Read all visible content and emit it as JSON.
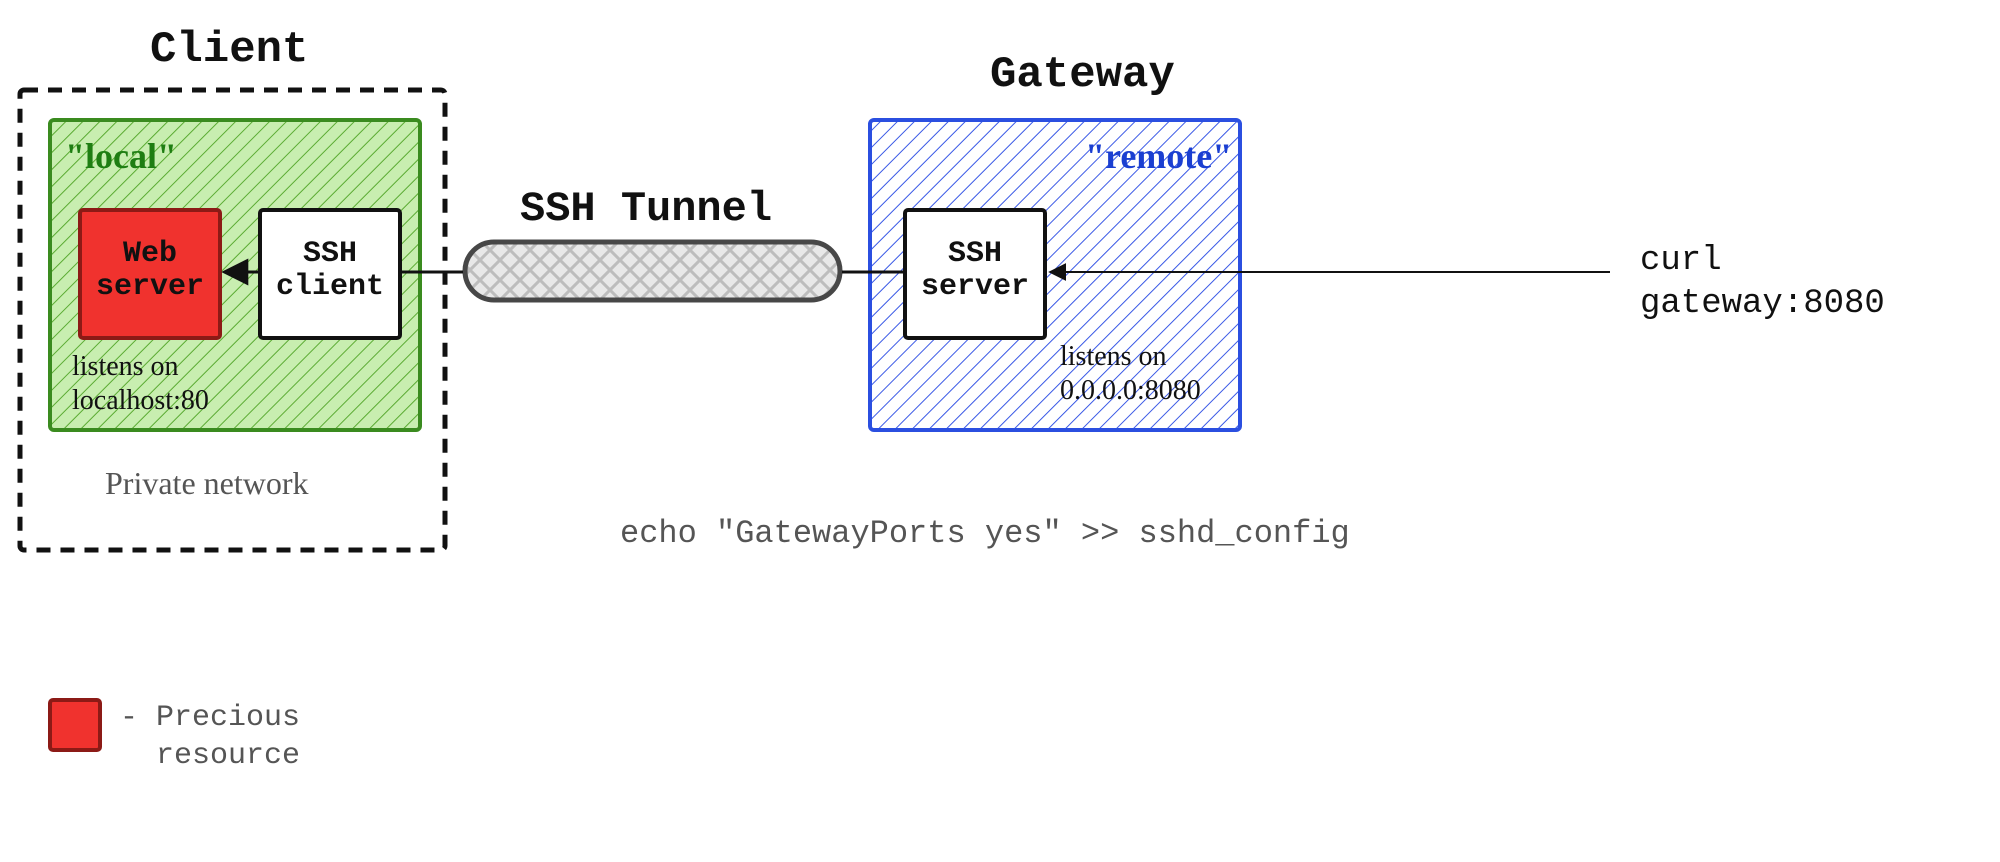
{
  "titles": {
    "client": "Client",
    "gateway": "Gateway",
    "tunnel": "SSH Tunnel"
  },
  "boxes": {
    "local_tag": "\"local\"",
    "remote_tag": "\"remote\"",
    "web_server": "Web\nserver",
    "ssh_client": "SSH\nclient",
    "ssh_server": "SSH\nserver"
  },
  "notes": {
    "listens_local": "listens on\nlocalhost:80",
    "listens_remote": "listens on\n0.0.0.0:8080",
    "private_network": "Private network",
    "curl_cmd": "curl\ngateway:8080",
    "sshd_config": "echo \"GatewayPorts yes\" >> sshd_config"
  },
  "legend": {
    "precious": "- Precious\n  resource"
  },
  "colors": {
    "green_fill": "#8ad364",
    "green_stroke": "#3a8b1f",
    "blue_stroke": "#2b4fe0",
    "red_fill": "#f0322e",
    "red_stroke": "#c52520",
    "tunnel_fill": "#d9d9d9",
    "tunnel_stroke": "#474747",
    "dash": "#111111"
  }
}
